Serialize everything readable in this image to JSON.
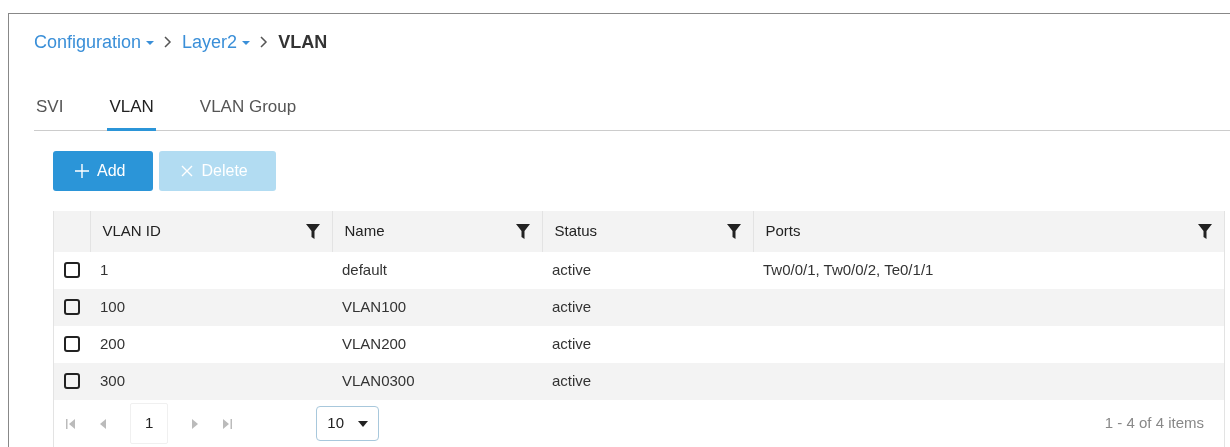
{
  "breadcrumb": [
    {
      "label": "Configuration",
      "kind": "dropdown"
    },
    {
      "label": "Layer2",
      "kind": "dropdown"
    },
    {
      "label": "VLAN",
      "kind": "current"
    }
  ],
  "tabs": [
    {
      "label": "SVI",
      "selected": false
    },
    {
      "label": "VLAN",
      "selected": true
    },
    {
      "label": "VLAN Group",
      "selected": false
    }
  ],
  "buttons": [
    {
      "label": "Add",
      "kind": "add",
      "disabled": false
    },
    {
      "label": "Delete",
      "kind": "delete",
      "disabled": true
    }
  ],
  "table": {
    "columns": [
      "VLAN ID",
      "Name",
      "Status",
      "Ports"
    ],
    "rows": [
      {
        "checked": false,
        "cells": [
          "1",
          "default",
          "active",
          "Tw0/0/1, Tw0/0/2, Te0/1/1"
        ]
      },
      {
        "checked": false,
        "cells": [
          "100",
          "VLAN100",
          "active",
          ""
        ]
      },
      {
        "checked": false,
        "cells": [
          "200",
          "VLAN200",
          "active",
          ""
        ]
      },
      {
        "checked": false,
        "cells": [
          "300",
          "VLAN0300",
          "active",
          ""
        ]
      }
    ]
  },
  "pager": {
    "page": "1",
    "page_size": "10",
    "summary": "1 - 4 of 4 items"
  }
}
